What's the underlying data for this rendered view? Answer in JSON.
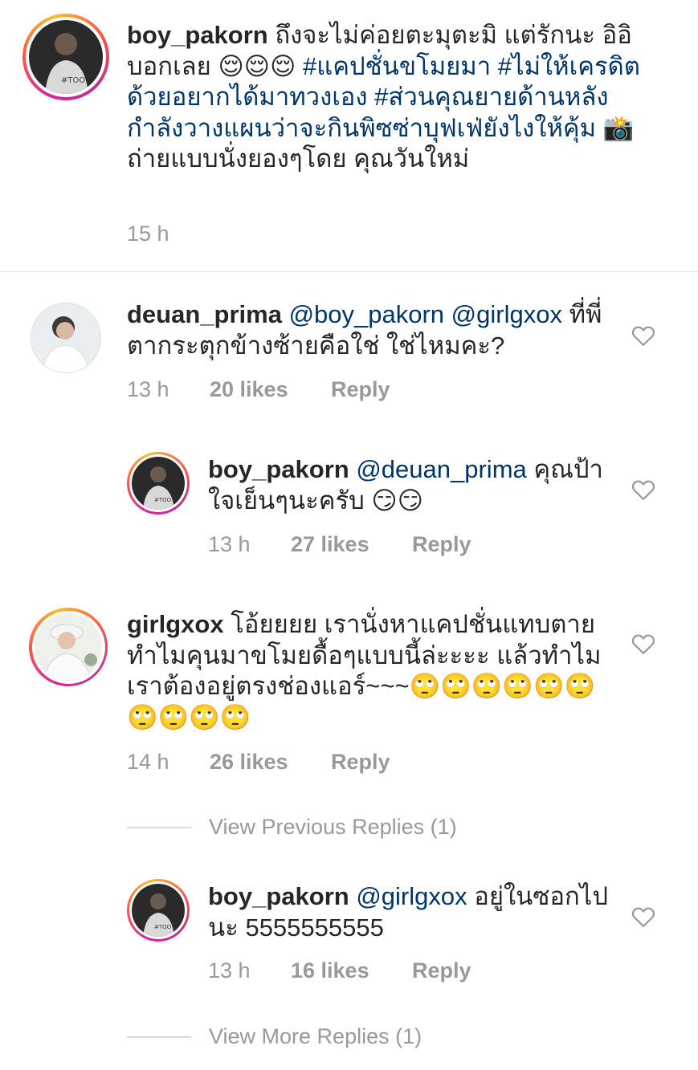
{
  "caption": {
    "username": "boy_pakorn",
    "text_1": " ถึงจะไม่ค่อยตะมุตะมิ แต่รักนะ อิอิ บอกเลย ",
    "emoji_1": "😌😌😌",
    "hashtag_1": " #แคปชั่นขโมยมา",
    "hashtag_2": " #ไม่ให้เครดิตด้วยอยากได้มาทวงเอง",
    "hashtag_3": " #ส่วนคุณยายด้านหลังกำลังวางแผนว่าจะกินพิซซ่าบุฟเฟ่ยังไงให้คุ้ม",
    "emoji_2": " 📸",
    "text_2": "ถ่ายแบบนั่งยองๆโดย คุณวันใหม่",
    "time": "15 h"
  },
  "comments": [
    {
      "username": "deuan_prima",
      "mention": " @boy_pakorn @girlgxox",
      "text": " ที่พี่ตากระตุกข้างซ้ายคือใช่ ใช่ไหมคะ?",
      "time": "13 h",
      "likes": "20 likes",
      "reply": "Reply"
    },
    {
      "username": "boy_pakorn",
      "mention": " @deuan_prima",
      "text": " คุณป้า ใจเย็นๆนะครับ 😏😏",
      "time": "13 h",
      "likes": "27 likes",
      "reply": "Reply"
    },
    {
      "username": "girlgxox",
      "mention": "",
      "text": " โอ้ยยยย เรานั่งหาแคปชั่นแทบตาย ทำไมคุนมาขโมยดื้อๆแบบนี้ล่ะะะะ แล้วทำไมเราต้องอยู่ตรงช่องแอร์~~~🙄🙄🙄🙄🙄🙄🙄🙄🙄🙄",
      "time": "14 h",
      "likes": "26 likes",
      "reply": "Reply"
    },
    {
      "username": "boy_pakorn",
      "mention": " @girlgxox",
      "text": " อยู่ในซอกไปนะ 5555555555",
      "time": "13 h",
      "likes": "16 likes",
      "reply": "Reply"
    }
  ],
  "view_previous_replies": "View Previous Replies (1)",
  "view_more_replies": "View More Replies (1)",
  "icons": {
    "heart": "heart-outline-icon",
    "avatar": "profile-photo"
  },
  "colors": {
    "username": "#262626",
    "link": "#003569",
    "meta": "#999999",
    "story_ring_start": "#d6249f",
    "story_ring_end": "#fdbb2d"
  }
}
